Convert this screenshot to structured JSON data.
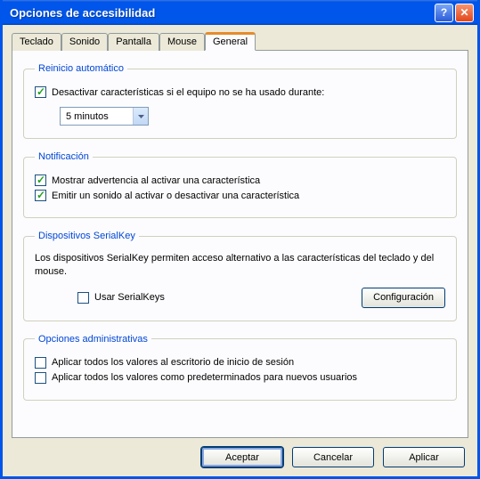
{
  "window": {
    "title": "Opciones de accesibilidad"
  },
  "tabs": {
    "teclado": "Teclado",
    "sonido": "Sonido",
    "pantalla": "Pantalla",
    "mouse": "Mouse",
    "general": "General"
  },
  "group_reset": {
    "legend": "Reinicio automático",
    "check_label": "Desactivar características si el equipo no se ha usado durante:",
    "checked": true,
    "dropdown_value": "5 minutos"
  },
  "group_notify": {
    "legend": "Notificación",
    "warn_label": "Mostrar advertencia al activar una característica",
    "warn_checked": true,
    "sound_label": "Emitir un sonido al activar o desactivar una característica",
    "sound_checked": true
  },
  "group_serial": {
    "legend": "Dispositivos SerialKey",
    "desc": "Los dispositivos SerialKey permiten acceso alternativo a las características del teclado y del mouse.",
    "use_label": "Usar SerialKeys",
    "use_checked": false,
    "config_btn": "Configuración"
  },
  "group_admin": {
    "legend": "Opciones administrativas",
    "logon_label": "Aplicar todos los valores al escritorio de inicio de sesión",
    "logon_checked": false,
    "newusers_label": "Aplicar todos los valores como predeterminados para nuevos usuarios",
    "newusers_checked": false
  },
  "buttons": {
    "ok": "Aceptar",
    "cancel": "Cancelar",
    "apply": "Aplicar"
  }
}
